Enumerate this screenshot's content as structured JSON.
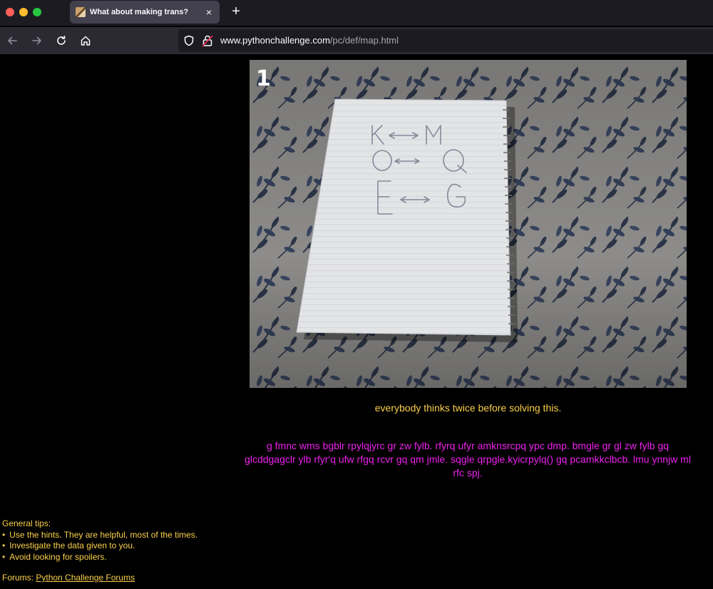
{
  "browser": {
    "tab_title": "What about making trans?",
    "tab_close": "×",
    "new_tab": "+",
    "url_host": "www.pythonchallenge.com",
    "url_path": "/pc/def/map.html"
  },
  "image": {
    "level_number": "1",
    "notebook_lines": [
      {
        "from": "K",
        "to": "M"
      },
      {
        "from": "O",
        "to": "Q"
      },
      {
        "from": "E",
        "to": "G"
      }
    ]
  },
  "hint": "everybody thinks twice before solving this.",
  "cipher": "g fmnc wms bgblr rpylqjyrc gr zw fylb. rfyrq ufyr amknsrcpq ypc dmp. bmgle gr gl zw fylb gq glcddgagclr ylb rfyr'q ufw rfgq rcvr gq qm jmle. sqgle qrpgle.kyicrpylq() gq pcamkkclbcb. lmu ynnjw ml rfc spj.",
  "tips": {
    "heading": "General tips:",
    "items": [
      "Use the hints. They are helpful, most of the times.",
      "Investigate the data given to you.",
      "Avoid looking for spoilers."
    ]
  },
  "forums": {
    "label": "Forums:",
    "link_text": "Python Challenge Forums"
  },
  "colors": {
    "hint": "#fbd04a",
    "cipher": "#ee22ee",
    "background": "#000000"
  }
}
